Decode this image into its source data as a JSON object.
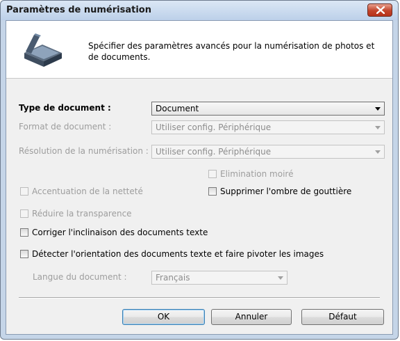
{
  "window": {
    "title": "Paramètres de numérisation"
  },
  "header": {
    "description": "Spécifier des paramètres avancés pour la numérisation de photos et de documents."
  },
  "fields": {
    "document_type": {
      "label": "Type de document :",
      "value": "Document"
    },
    "document_format": {
      "label": "Format de document :",
      "value": "Utiliser config. Périphérique"
    },
    "scan_resolution": {
      "label": "Résolution de la numérisation :",
      "value": "Utiliser config. Périphérique"
    },
    "document_language": {
      "label": "Langue du document :",
      "value": "Français"
    }
  },
  "checkboxes": {
    "moire": "Elimination moiré",
    "sharpness": "Accentuation de la netteté",
    "gutter_shadow": "Supprimer l'ombre de gouttière",
    "transparency": "Réduire la transparence",
    "skew": "Corriger l'inclinaison des documents texte",
    "orientation": "Détecter l'orientation des documents texte et faire pivoter les images"
  },
  "buttons": {
    "ok": "OK",
    "cancel": "Annuler",
    "default": "Défaut"
  }
}
